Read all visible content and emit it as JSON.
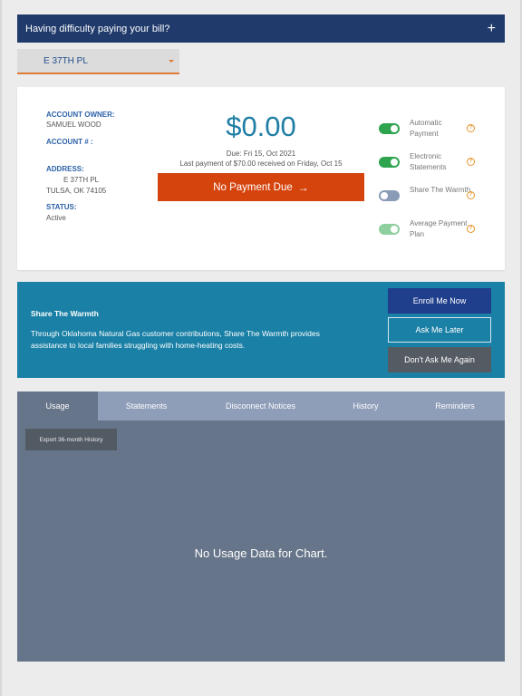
{
  "help_bar": {
    "text": "Having difficulty paying your bill?",
    "toggle_glyph": "+"
  },
  "address_select": {
    "selected": "E 37TH PL"
  },
  "account": {
    "owner_label": "ACCOUNT OWNER:",
    "owner_value": "SAMUEL WOOD",
    "number_label": "ACCOUNT # :",
    "number_value": "",
    "address_label": "ADDRESS:",
    "address_line1": "E 37TH PL",
    "address_line2": "TULSA, OK 74105",
    "status_label": "STATUS:",
    "status_value": "Active"
  },
  "billing": {
    "amount": "$0.00",
    "due_text": "Due: Fri 15, Oct 2021",
    "last_payment_text": "Last payment of $70.00 received on Friday, Oct 15",
    "pay_button_label": "No Payment Due",
    "pay_button_icon": "arrow-right-icon"
  },
  "settings": {
    "items": [
      {
        "label": "Automatic Payment",
        "state": "on"
      },
      {
        "label": "Electronic Statements",
        "state": "on"
      },
      {
        "label": "Share The Warmth",
        "state": "off"
      },
      {
        "label": "Average Payment Plan",
        "state": "on-disabled"
      }
    ],
    "help_glyph": "?"
  },
  "share_warmth": {
    "title": "Share The Warmth",
    "description": "Through Oklahoma Natural Gas customer contributions, Share The Warmth provides assistance to local families struggling with home-heating costs.",
    "enroll_label": "Enroll Me Now",
    "later_label": "Ask Me Later",
    "dont_label": "Don't Ask Me Again"
  },
  "tabs": {
    "items": [
      "Usage",
      "Statements",
      "Disconnect Notices",
      "History",
      "Reminders"
    ],
    "active": "Usage",
    "export_label": "Export 36-month History",
    "empty_message": "No Usage Data for Chart."
  },
  "colors": {
    "header_navy": "#1f3a6b",
    "amount_blue": "#1f7ea5",
    "pay_orange": "#d6440e",
    "toggle_green": "#2ea44f",
    "warmth_teal": "#1a80a6",
    "panel_slate": "#667589"
  }
}
